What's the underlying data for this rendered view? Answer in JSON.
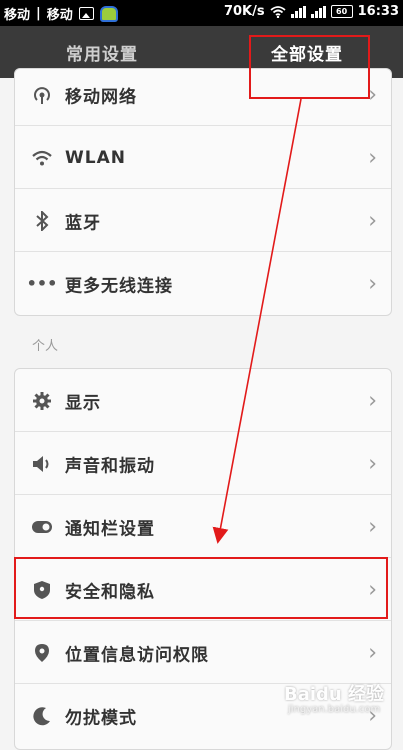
{
  "status_bar": {
    "carrier1": "移动",
    "carrier2": "移动",
    "net_speed": "70K/s",
    "battery": "60",
    "time": "16:33"
  },
  "tabs": {
    "common": "常用设置",
    "all": "全部设置"
  },
  "wireless": {
    "items": [
      {
        "icon": "antenna-icon",
        "label": "移动网络"
      },
      {
        "icon": "wifi-icon",
        "label": "WLAN"
      },
      {
        "icon": "bluetooth-icon",
        "label": "蓝牙"
      },
      {
        "icon": "more-dots-icon",
        "label": "更多无线连接"
      }
    ]
  },
  "personal": {
    "section_title": "个人",
    "items": [
      {
        "icon": "gear-icon",
        "label": "显示"
      },
      {
        "icon": "speaker-icon",
        "label": "声音和振动"
      },
      {
        "icon": "toggle-icon",
        "label": "通知栏设置"
      },
      {
        "icon": "shield-icon",
        "label": "安全和隐私"
      },
      {
        "icon": "location-pin-icon",
        "label": "位置信息访问权限"
      },
      {
        "icon": "moon-icon",
        "label": "勿扰模式"
      }
    ]
  },
  "watermark": {
    "text": "Baidu 经验",
    "url": "jingyan.baidu.com"
  },
  "colors": {
    "annotation": "#e21a1a",
    "header_bg": "#3a3a3a"
  }
}
